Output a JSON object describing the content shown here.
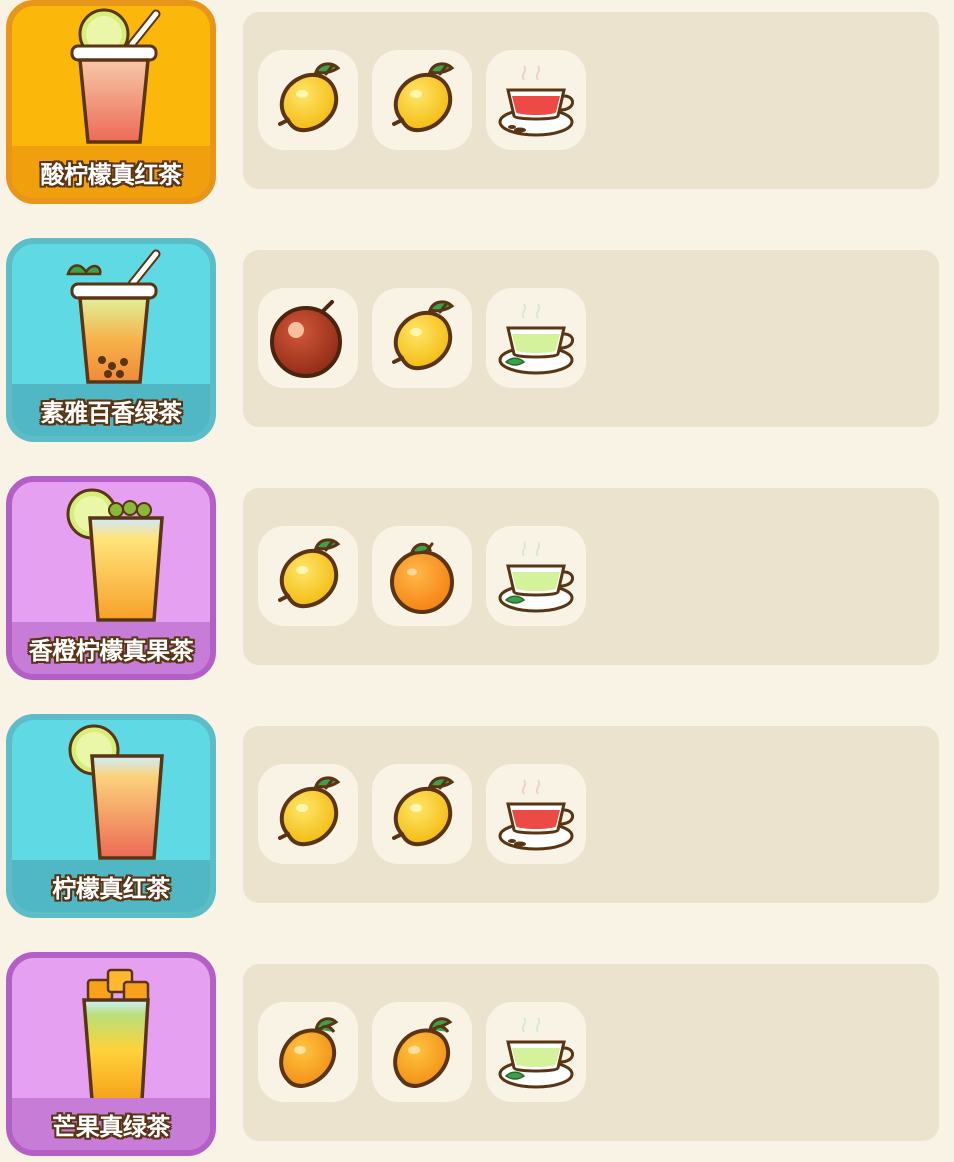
{
  "recipes": [
    {
      "name": "酸柠檬真红茶",
      "card_color": "#fbb80a",
      "card_border": "#e8961a",
      "band_color": "#efa00c",
      "drink_icon": "lemon-black-tea-drink-icon",
      "ingredients": [
        "lemon-icon",
        "lemon-icon",
        "black-tea-icon"
      ]
    },
    {
      "name": "素雅百香绿茶",
      "card_color": "#5fd9e3",
      "card_border": "#5cbcc7",
      "band_color": "#4fb8c4",
      "drink_icon": "passion-fruit-green-tea-drink-icon",
      "ingredients": [
        "passion-fruit-icon",
        "lemon-icon",
        "green-tea-icon"
      ]
    },
    {
      "name": "香橙柠檬真果茶",
      "card_color": "#e6a0f2",
      "card_border": "#b35fc6",
      "band_color": "#c77cd8",
      "drink_icon": "orange-lemon-fruit-tea-drink-icon",
      "ingredients": [
        "lemon-icon",
        "orange-icon",
        "green-tea-icon"
      ]
    },
    {
      "name": "柠檬真红茶",
      "card_color": "#5fd9e3",
      "card_border": "#5cbcc7",
      "band_color": "#4fb8c4",
      "drink_icon": "lemon-red-tea-drink-icon",
      "ingredients": [
        "lemon-icon",
        "lemon-icon",
        "black-tea-icon"
      ]
    },
    {
      "name": "芒果真绿茶",
      "card_color": "#e6a0f2",
      "card_border": "#b35fc6",
      "band_color": "#c77cd8",
      "drink_icon": "mango-green-tea-drink-icon",
      "ingredients": [
        "mango-icon",
        "mango-icon",
        "green-tea-icon"
      ]
    }
  ]
}
